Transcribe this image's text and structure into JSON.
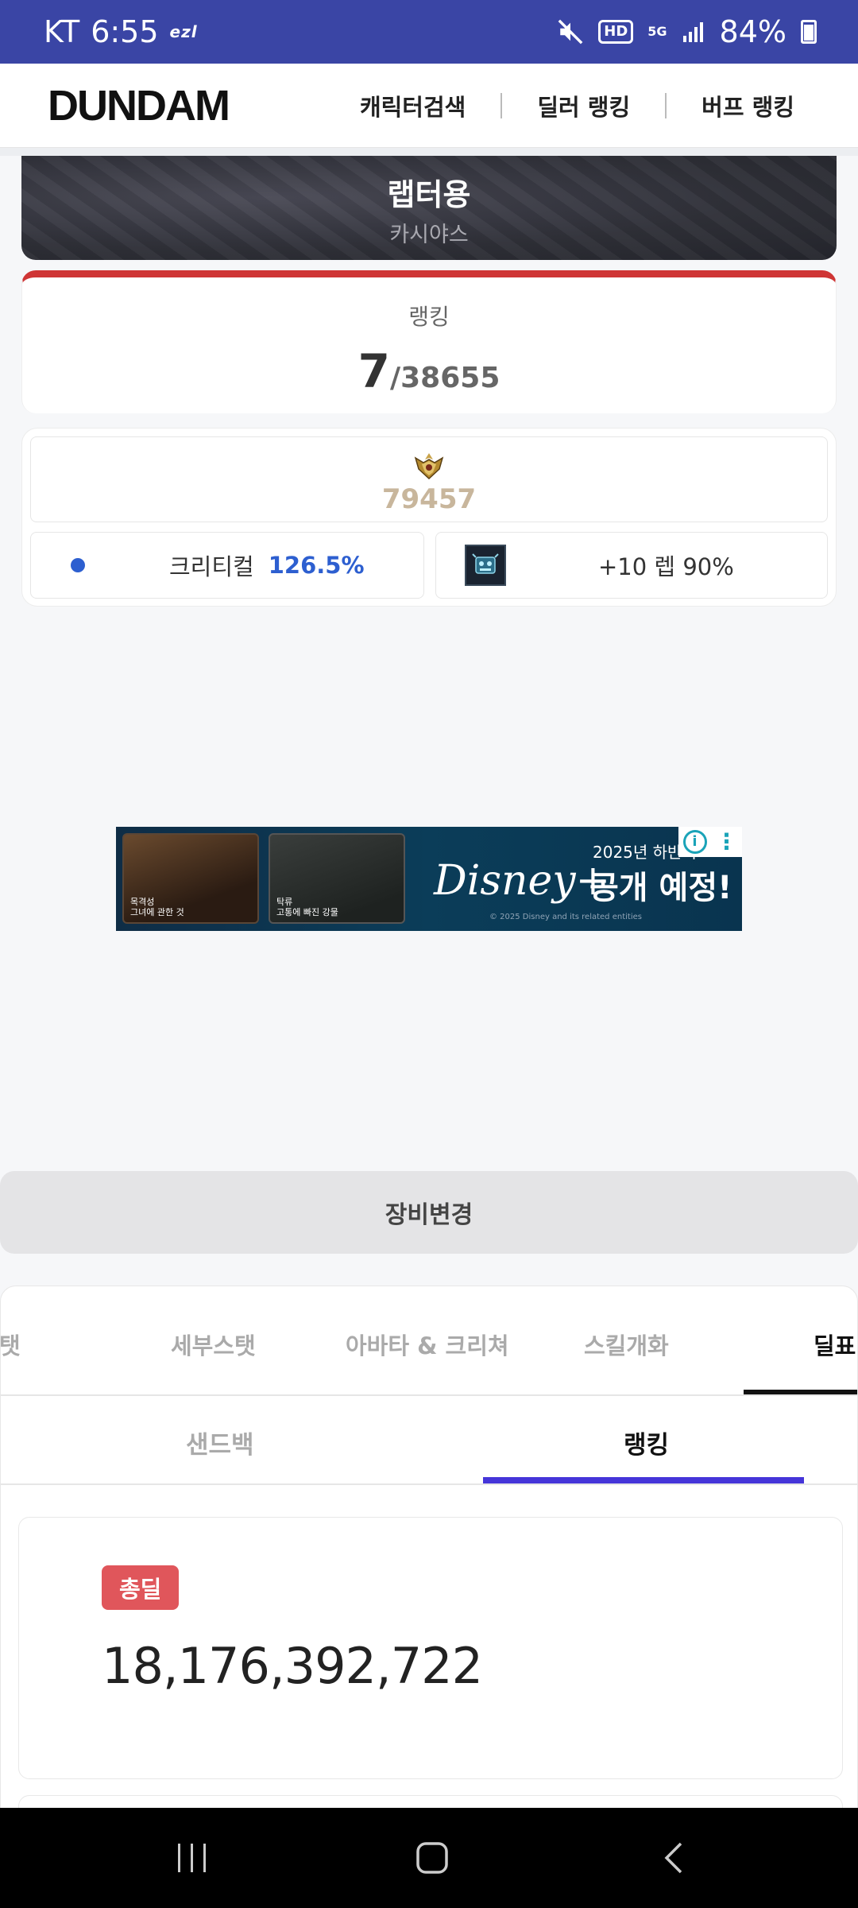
{
  "status_bar": {
    "carrier": "KT",
    "time": "6:55",
    "carrier_tag": "ezl",
    "hd": "HD",
    "network": "5G",
    "battery": "84%"
  },
  "nav": {
    "logo": "DUNDAM",
    "links": [
      "캐릭터검색",
      "딜러 랭킹",
      "버프 랭킹"
    ]
  },
  "hero": {
    "name": "랩터용",
    "server": "카시야스"
  },
  "ranking": {
    "label": "랭킹",
    "rank": "7",
    "total": "/38655"
  },
  "stats": {
    "score": "79457",
    "crit_label": "크리티컬",
    "crit_value": "126.5%",
    "item_label": "+10 렙 90%"
  },
  "ad": {
    "thumb1_caption": "목격성\n그녀에 관한 것",
    "thumb2_caption": "탁류\n고통에 빠진 강물",
    "brand": "Disney+",
    "year": "2025년 하반기",
    "headline": "공개 예정!",
    "fine_print": "© 2025 Disney and its related entities"
  },
  "equip_button": "장비변경",
  "main_tabs": [
    "탯",
    "세부스탯",
    "아바타 & 크리쳐",
    "스킬개화",
    "딜표"
  ],
  "active_main_tab": "딜표",
  "sub_tabs": [
    "샌드백",
    "랭킹"
  ],
  "active_sub_tab": "랭킹",
  "deal": {
    "badge": "총딜",
    "value": "18,176,392,722"
  },
  "colors": {
    "status_bar": "#3a45a5",
    "rank_accent": "#cf3535",
    "crit_blue": "#2d5fd0",
    "score_gold": "#c8b69c",
    "sub_tab_underline": "#4535d9",
    "deal_badge": "#e0565b"
  }
}
